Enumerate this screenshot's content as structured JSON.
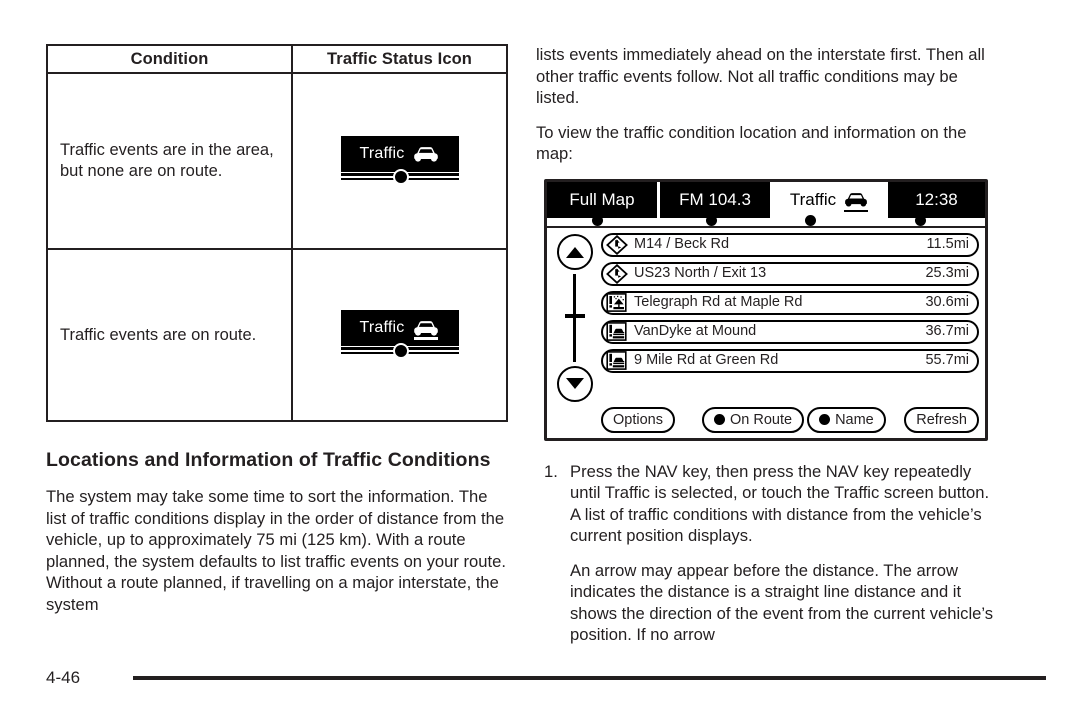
{
  "table": {
    "headers": [
      "Condition",
      "Traffic Status Icon"
    ],
    "rows": [
      {
        "condition": "Traffic events are in the area, but none are on route.",
        "icon_label": "Traffic",
        "icon_name": "traffic-status-icon-off-route",
        "icon_on_route": false
      },
      {
        "condition": "Traffic events are on route.",
        "icon_label": "Traffic",
        "icon_name": "traffic-status-icon-on-route",
        "icon_on_route": true
      }
    ]
  },
  "left_column": {
    "heading": "Locations and Information of Traffic Conditions",
    "paragraph": "The system may take some time to sort the information. The list of traffic conditions display in the order of distance from the vehicle, up to approximately 75 mi (125 km). With a route planned, the system defaults to list traffic events on your route. Without a route planned, if travelling on a major interstate, the system"
  },
  "right_column": {
    "paragraph_1": "lists events immediately ahead on the interstate first. Then all other traffic events follow. Not all traffic conditions may be listed.",
    "paragraph_2": "To view the traffic condition location and information on the map:",
    "steps": [
      {
        "marker": "1.",
        "paragraphs": [
          "Press the NAV key, then press the NAV key repeatedly until Traffic is selected, or touch the Traffic screen button. A list of traffic conditions with distance from the vehicle’s current position displays.",
          "An arrow may appear before the distance. The arrow indicates the distance is a straight line distance and it shows the direction of the event from the current vehicle’s position. If no arrow"
        ]
      }
    ]
  },
  "nav_screen": {
    "tabs": [
      {
        "label": "Full Map",
        "selected": false,
        "has_car_icon": false
      },
      {
        "label": "FM 104.3",
        "selected": false,
        "has_car_icon": false
      },
      {
        "label": "Traffic",
        "selected": true,
        "has_car_icon": true
      },
      {
        "label": "12:38",
        "selected": false,
        "has_car_icon": false
      }
    ],
    "events": [
      {
        "name": "M14 / Beck Rd",
        "distance": "11.5mi",
        "icon": "hazard-diamond-icon"
      },
      {
        "name": "US23 North / Exit 13",
        "distance": "25.3mi",
        "icon": "hazard-diamond-icon"
      },
      {
        "name": "Telegraph Rd at Maple Rd",
        "distance": "30.6mi",
        "icon": "weather-alert-square-icon"
      },
      {
        "name": "VanDyke at Mound",
        "distance": "36.7mi",
        "icon": "accident-alert-square-icon"
      },
      {
        "name": "9 Mile Rd at Green Rd",
        "distance": "55.7mi",
        "icon": "accident-alert-square-icon"
      }
    ],
    "buttons": [
      {
        "label": "Options",
        "has_radio": false
      },
      {
        "label": "On Route",
        "has_radio": true
      },
      {
        "label": "Name",
        "has_radio": true
      },
      {
        "label": "Refresh",
        "has_radio": false
      }
    ],
    "scroll": {
      "up_icon": "scroll-up-arrow-icon",
      "down_icon": "scroll-down-arrow-icon"
    }
  },
  "footer": {
    "page_number": "4-46"
  },
  "colors": {
    "ink": "#231f20",
    "black": "#000000",
    "paper": "#ffffff"
  }
}
